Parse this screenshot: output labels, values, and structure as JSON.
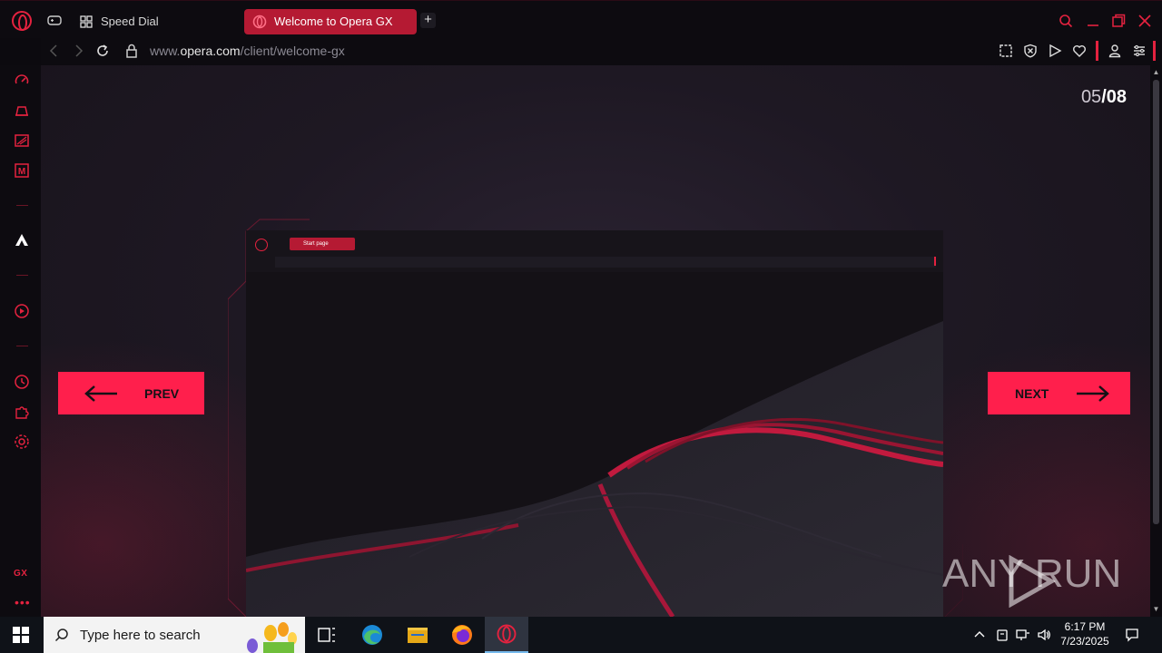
{
  "tabs": {
    "speed_dial": "Speed Dial",
    "active": "Welcome to Opera GX",
    "new_tab": "+"
  },
  "address": {
    "url_prefix": "www.",
    "url_domain": "opera.com",
    "url_path": "/client/welcome-gx"
  },
  "sidebar": {
    "gx_label": "GX",
    "more_label": "•••"
  },
  "content": {
    "counter_current": "05",
    "counter_total": "/08",
    "faded_heading": "",
    "preview_tab": "Start page",
    "prev_label": "PREV",
    "next_label": "NEXT"
  },
  "watermark": "ANY  RUN",
  "taskbar": {
    "search_placeholder": "Type here to search",
    "time": "6:17 PM",
    "date": "7/23/2025"
  },
  "colors": {
    "accent": "#e4223f",
    "button": "#ff1f4c",
    "active_tab": "#b51a33"
  }
}
